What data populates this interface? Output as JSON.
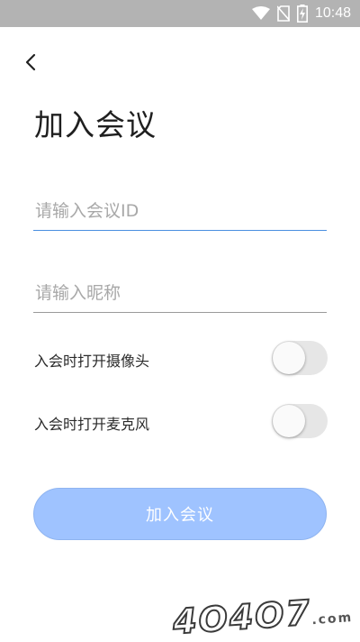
{
  "status_bar": {
    "time": "10:48",
    "icons": [
      "wifi-icon",
      "no-sim-icon",
      "battery-charging-icon"
    ]
  },
  "header": {
    "back_icon": "chevron-left-icon",
    "title": "加入会议"
  },
  "form": {
    "meeting_id": {
      "placeholder": "请输入会议ID",
      "value": ""
    },
    "nickname": {
      "placeholder": "请输入昵称",
      "value": ""
    }
  },
  "toggles": {
    "camera": {
      "label": "入会时打开摄像头",
      "on": false
    },
    "microphone": {
      "label": "入会时打开麦克风",
      "on": false
    }
  },
  "join_button": {
    "label": "加入会议"
  },
  "watermark": {
    "text": "4O4O7",
    "suffix": ".com"
  },
  "colors": {
    "accent_underline": "#4a8fe0",
    "button_bg": "#9fc3ff",
    "status_bar_bg": "#b3b3b3",
    "switch_off": "#e6e6e6"
  }
}
